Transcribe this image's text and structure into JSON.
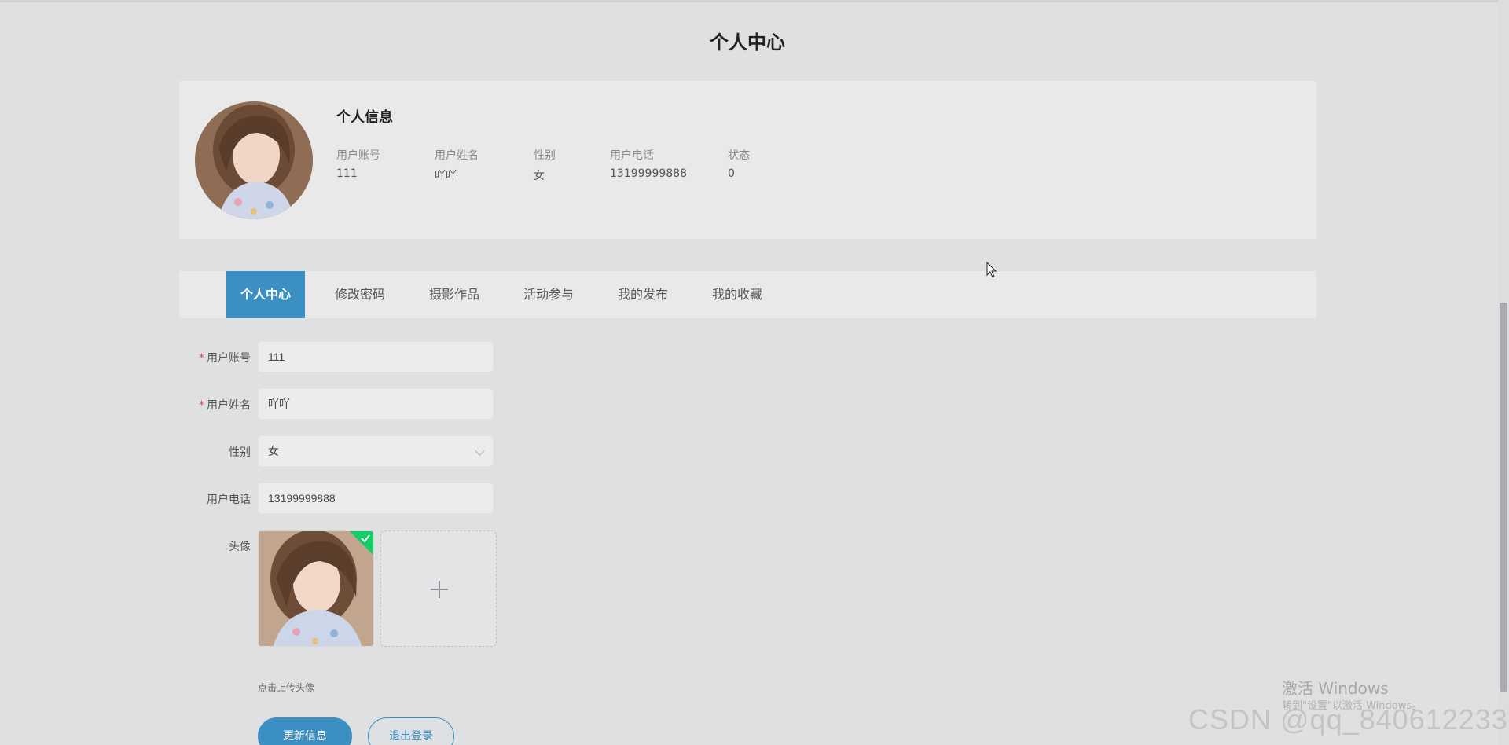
{
  "page": {
    "title": "个人中心"
  },
  "profile": {
    "heading": "个人信息",
    "fields": [
      {
        "label": "用户账号",
        "value": "111"
      },
      {
        "label": "用户姓名",
        "value": "吖吖"
      },
      {
        "label": "性别",
        "value": "女"
      },
      {
        "label": "用户电话",
        "value": "13199999888"
      },
      {
        "label": "状态",
        "value": "0"
      }
    ]
  },
  "tabs": [
    {
      "label": "个人中心",
      "active": true
    },
    {
      "label": "修改密码",
      "active": false
    },
    {
      "label": "摄影作品",
      "active": false
    },
    {
      "label": "活动参与",
      "active": false
    },
    {
      "label": "我的发布",
      "active": false
    },
    {
      "label": "我的收藏",
      "active": false
    }
  ],
  "form": {
    "account": {
      "label": "用户账号",
      "value": "111",
      "required": true
    },
    "name": {
      "label": "用户姓名",
      "value": "吖吖",
      "required": true
    },
    "gender": {
      "label": "性别",
      "value": "女"
    },
    "phone": {
      "label": "用户电话",
      "value": "13199999888"
    },
    "avatar": {
      "label": "头像",
      "hint": "点击上传头像"
    },
    "required_mark": "*",
    "submit_label": "更新信息",
    "logout_label": "退出登录"
  },
  "watermark": {
    "activate_line1": "激活 Windows",
    "activate_line2": "转到\"设置\"以激活 Windows。",
    "csdn": "CSDN @qq_840612233"
  },
  "colors": {
    "accent": "#3b8fc2",
    "success": "#13ce66",
    "required": "#e0474d"
  },
  "icons": {
    "gender_select": "chevron-down-icon",
    "upload": "plus-icon",
    "upload_success": "check-icon",
    "pointer": "mouse-cursor-icon"
  }
}
